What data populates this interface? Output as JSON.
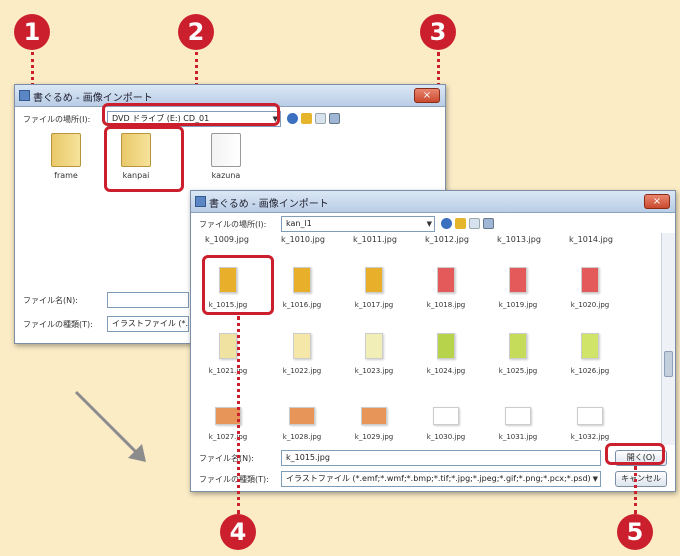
{
  "badges": [
    "1",
    "2",
    "3",
    "4",
    "5"
  ],
  "dialog1": {
    "title": "書ぐるめ - 画像インポート",
    "location_label": "ファイルの場所(I):",
    "location_value": "DVD ドライブ (E:) CD_01",
    "folders": [
      "frame",
      "kanpai",
      "kazuna"
    ],
    "filename_label": "ファイル名(N):",
    "filetype_label": "ファイルの種類(T):",
    "filetype_value": "イラストファイル (*.emf;*",
    "close": "×"
  },
  "dialog2": {
    "title": "書ぐるめ - 画像インポート",
    "location_label": "ファイルの場所(I):",
    "location_value": "kan_l1",
    "top_row": [
      "k_1009.jpg",
      "k_1010.jpg",
      "k_1011.jpg",
      "k_1012.jpg",
      "k_1013.jpg",
      "k_1014.jpg"
    ],
    "files": [
      {
        "name": "k_1015.jpg",
        "color": "#e8b02a"
      },
      {
        "name": "k_1016.jpg",
        "color": "#e8b02a"
      },
      {
        "name": "k_1017.jpg",
        "color": "#e8b02a"
      },
      {
        "name": "k_1018.jpg",
        "color": "#e45a5a"
      },
      {
        "name": "k_1019.jpg",
        "color": "#e45a5a"
      },
      {
        "name": "k_1020.jpg",
        "color": "#e45a5a"
      },
      {
        "name": "k_1021.jpg",
        "color": "#f0e3a2"
      },
      {
        "name": "k_1022.jpg",
        "color": "#f4e7a8"
      },
      {
        "name": "k_1023.jpg",
        "color": "#f2eeb8"
      },
      {
        "name": "k_1024.jpg",
        "color": "#b7d34c"
      },
      {
        "name": "k_1025.jpg",
        "color": "#c4dc5a"
      },
      {
        "name": "k_1026.jpg",
        "color": "#d0e46a"
      },
      {
        "name": "k_1027.jpg",
        "color": "#e8955a"
      },
      {
        "name": "k_1028.jpg",
        "color": "#e8955a"
      },
      {
        "name": "k_1029.jpg",
        "color": "#e8955a"
      },
      {
        "name": "k_1030.jpg",
        "color": "#ffffff"
      },
      {
        "name": "k_1031.jpg",
        "color": "#ffffff"
      },
      {
        "name": "k_1032.jpg",
        "color": "#ffffff"
      }
    ],
    "filename_label": "ファイル名(N):",
    "filename_value": "k_1015.jpg",
    "filetype_label": "ファイルの種類(T):",
    "filetype_value": "イラストファイル (*.emf;*.wmf;*.bmp;*.tif;*.jpg;*.jpeg;*.gif;*.png;*.pcx;*.psd)",
    "open": "開く(O)",
    "cancel": "キャンセル",
    "close": "×"
  }
}
